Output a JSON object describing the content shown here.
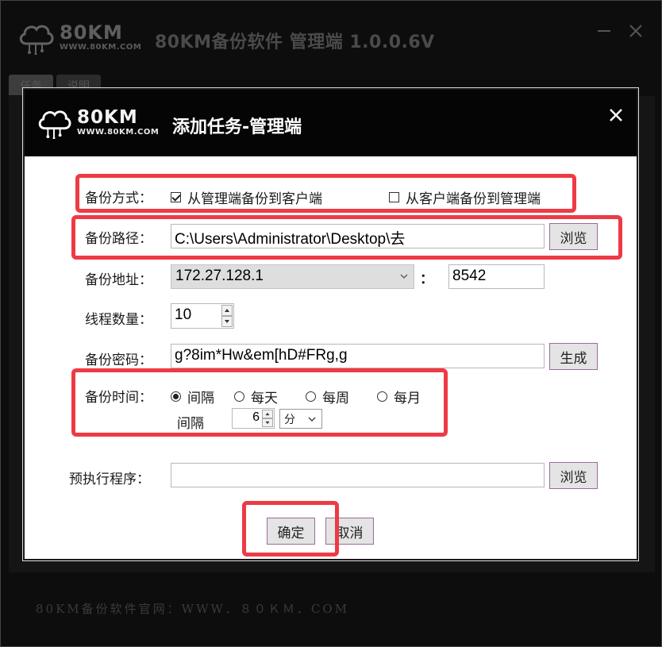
{
  "main_window": {
    "logo": {
      "brand": "80KM",
      "site": "WWW.80KM.COM"
    },
    "title": "80KM备份软件 管理端 1.0.0.6V",
    "tabs": [
      {
        "label": "任务"
      },
      {
        "label": "说明"
      }
    ],
    "footer": "80KM备份软件官网：WWW．８０ＫＭ．COM",
    "icons": {
      "minimize": "minimize-icon",
      "close": "close-icon"
    }
  },
  "dialog": {
    "logo": {
      "brand": "80KM",
      "site": "WWW.80KM.COM"
    },
    "title": "添加任务-管理端",
    "close_icon": "close-icon",
    "backup_mode": {
      "label": "备份方式：",
      "options": [
        {
          "label": "从管理端备份到客户端",
          "checked": true
        },
        {
          "label": "从客户端备份到管理端",
          "checked": false
        }
      ]
    },
    "backup_path": {
      "label": "备份路径：",
      "value": "C:\\Users\\Administrator\\Desktop\\去",
      "browse": "浏览"
    },
    "backup_address": {
      "label": "备份地址：",
      "ip": "172.27.128.1",
      "separator": "：",
      "port": "8542"
    },
    "thread_count": {
      "label": "线程数量：",
      "value": "10"
    },
    "backup_password": {
      "label": "备份密码：",
      "value": "g?8im*Hw&em[hD#FRg,g",
      "generate": "生成"
    },
    "backup_time": {
      "label": "备份时间：",
      "options": [
        {
          "label": "间隔",
          "checked": true
        },
        {
          "label": "每天",
          "checked": false
        },
        {
          "label": "每周",
          "checked": false
        },
        {
          "label": "每月",
          "checked": false
        }
      ],
      "interval_label": "间隔",
      "interval_value": "6",
      "interval_unit": "分"
    },
    "pre_exec": {
      "label": "预执行程序：",
      "value": "",
      "browse": "浏览"
    },
    "ok": "确定",
    "cancel": "取消"
  },
  "colors": {
    "highlight": "#ee3a45",
    "button_border": "#9b6b9b",
    "header_bg": "#050505"
  }
}
